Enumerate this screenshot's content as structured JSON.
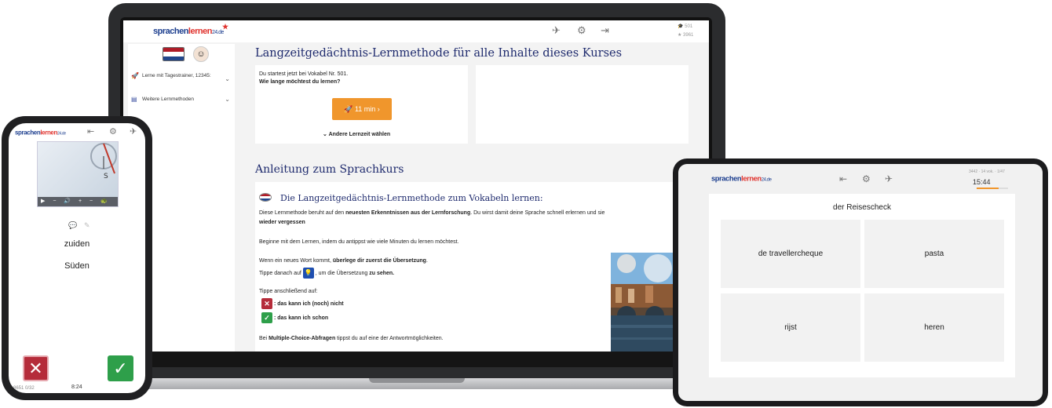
{
  "brand": {
    "part1": "sprachen",
    "part2": "lernen",
    "part3": "24.de"
  },
  "laptop": {
    "stats": {
      "vocab": "501",
      "points": "3961"
    },
    "sidebar": {
      "items": [
        {
          "label": "Lerne mit Tagestrainer, 12345:"
        },
        {
          "label": "Weitere Lernmethoden"
        }
      ]
    },
    "main_title": "Langzeitgedächtnis-Lernmethode für alle Inhalte dieses Kurses",
    "start_card": {
      "line1": "Du startest jetzt bei Vokabel Nr. 501.",
      "line2": "Wie lange möchtest du lernen?",
      "button_label": "11 min  ›",
      "other_time": "Andere Lernzeit wählen"
    },
    "section_title": "Anleitung zum Sprachkurs",
    "guide": {
      "title": "Die Langzeitgedächtnis-Lernmethode zum Vokabeln lernen:",
      "p1_a": "Diese Lernmethode beruht auf den ",
      "p1_b": "neuesten Erkenntnissen aus der Lernforschung",
      "p1_c": ". Du wirst damit deine Sprache schnell erlernen und sie ",
      "p1_d": "wieder vergessen",
      "p2": "Beginne mit dem Lernen, indem du antippst wie viele Minuten du lernen möchtest.",
      "p3_a": "Wenn ein neues Wort kommt, ",
      "p3_b": "überlege dir zuerst die Übersetzung",
      "p4_a": "Tippe danach auf",
      "p4_b": ", um die Übersetzung ",
      "p4_c": "zu sehen.",
      "p5": "Tippe anschließend auf:",
      "cant": ": das kann ich (noch) nicht",
      "can": ": das kann ich schon",
      "p6_a": "Bei ",
      "p6_b": "Multiple-Choice-Abfragen",
      "p6_c": " tippst du auf eine der Antwortmöglichkeiten."
    }
  },
  "phone": {
    "word_nl": "zuiden",
    "word_de": "Süden",
    "footer": {
      "left": "8651  0/32",
      "time": "8:24"
    },
    "video_controls": "▶ − 🔊 + − 🐢 +"
  },
  "tablet": {
    "stats": "3442 · 14 vok. · 1/47",
    "time": "15:44",
    "progress": 0.7,
    "prompt": "der Reisescheck",
    "options": [
      "de travellercheque",
      "pasta",
      "rijst",
      "heren"
    ]
  },
  "colors": {
    "brand_blue": "#1d3f8f",
    "brand_red": "#e0332e",
    "orange": "#f0962c",
    "wrong": "#b52c3a",
    "right": "#2e9f4a"
  }
}
